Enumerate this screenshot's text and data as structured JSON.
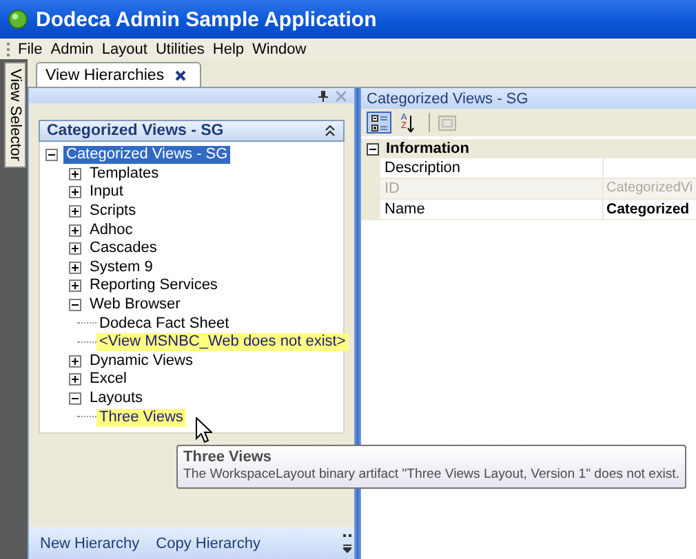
{
  "window": {
    "title": "Dodeca Admin Sample Application"
  },
  "menu": [
    "File",
    "Admin",
    "Layout",
    "Utilities",
    "Help",
    "Window"
  ],
  "side_tab": {
    "label": "View Selector"
  },
  "tabs": [
    {
      "label": "View Hierarchies",
      "selected": true
    }
  ],
  "left_panel": {
    "group_title": "Categorized Views - SG",
    "tree": [
      {
        "label": "Categorized Views - SG",
        "selected": true,
        "missing": false,
        "expanded": true,
        "children": [
          {
            "label": "Templates",
            "selected": false,
            "missing": false,
            "expanded": false
          },
          {
            "label": "Input",
            "selected": false,
            "missing": false,
            "expanded": false
          },
          {
            "label": "Scripts",
            "selected": false,
            "missing": false,
            "expanded": false
          },
          {
            "label": "Adhoc",
            "selected": false,
            "missing": false,
            "expanded": false
          },
          {
            "label": "Cascades",
            "selected": false,
            "missing": false,
            "expanded": false
          },
          {
            "label": "System 9",
            "selected": false,
            "missing": false,
            "expanded": false
          },
          {
            "label": "Reporting Services",
            "selected": false,
            "missing": false,
            "expanded": false
          },
          {
            "label": "Web Browser",
            "selected": false,
            "missing": false,
            "expanded": true,
            "children": [
              {
                "label": "Dodeca Fact Sheet",
                "selected": false,
                "missing": false
              },
              {
                "label": "<View MSNBC_Web does not exist>",
                "selected": false,
                "missing": true
              }
            ]
          },
          {
            "label": "Dynamic Views",
            "selected": false,
            "missing": false,
            "expanded": false
          },
          {
            "label": "Excel",
            "selected": false,
            "missing": false,
            "expanded": false
          },
          {
            "label": "Layouts",
            "selected": false,
            "missing": false,
            "expanded": true,
            "children": [
              {
                "label": "Three Views",
                "selected": false,
                "missing": true
              }
            ]
          }
        ]
      }
    ],
    "footer_links": [
      "New Hierarchy",
      "Copy Hierarchy"
    ]
  },
  "right_panel": {
    "title": "Categorized Views - SG",
    "toolbar": [
      {
        "kind": "categorized",
        "selected": true
      },
      {
        "kind": "alphabetical",
        "selected": false,
        "glyphs": [
          "A",
          "Z"
        ]
      }
    ],
    "category": {
      "label": "Information",
      "expanded": true
    },
    "properties": [
      {
        "name": "Description",
        "disabled": false
      },
      {
        "name": "ID",
        "value": "CategorizedVi",
        "disabled": true,
        "modified": false
      },
      {
        "name": "Name",
        "value": "Categorized",
        "disabled": false,
        "modified": true
      }
    ]
  },
  "tooltip": {
    "title": "Three Views",
    "text": "The WorkspaceLayout binary artifact \"Three Views Layout, Version 1\" does not exist."
  }
}
